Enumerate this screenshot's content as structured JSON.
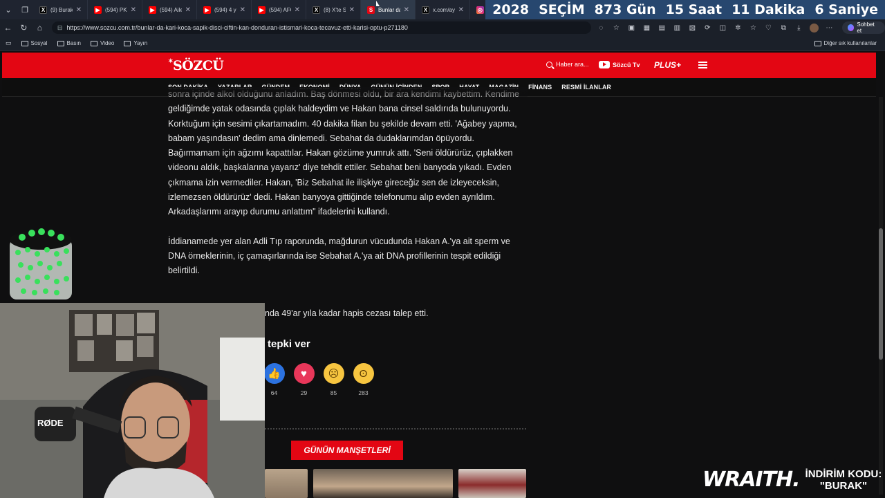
{
  "browser": {
    "tabs": [
      {
        "label": "(9) BurakSe",
        "icon": "x-icon"
      },
      {
        "label": "(594) PKK/Y",
        "icon": "youtube-icon"
      },
      {
        "label": "(594) Aile e",
        "icon": "youtube-icon"
      },
      {
        "label": "(594) 4 yaş",
        "icon": "youtube-icon"
      },
      {
        "label": "(594) AFGA",
        "icon": "youtube-icon"
      },
      {
        "label": "(8) X'te Sö",
        "icon": "x-icon"
      },
      {
        "label": "Bunlar da k",
        "icon": "sozcu-icon",
        "active": true
      },
      {
        "label": "x.com/ayk",
        "icon": "x-icon"
      },
      {
        "label": "(9) Instagra",
        "icon": "instagram-icon"
      }
    ],
    "url": "https://www.sozcu.com.tr/bunlar-da-kari-koca-sapik-disci-ciftin-kan-donduran-istismari-koca-tecavuz-etti-karisi-optu-p271180",
    "chat_button": "Sohbet et",
    "bookmarks": [
      "Sosyal",
      "Basın",
      "Video",
      "Yayın"
    ],
    "other_bookmarks": "Diğer sık kullanılanlar"
  },
  "countdown": {
    "year": "2028",
    "title": "SEÇİM",
    "days": "873 Gün",
    "hours": "15 Saat",
    "minutes": "11 Dakika",
    "seconds": "6 Saniye"
  },
  "site": {
    "logo": "SÖZCÜ",
    "search_placeholder": "Haber ara...",
    "tv_label": "Sözcü Tv",
    "plus_label": "PLUS+",
    "nav": [
      "SON DAKİKA",
      "YAZARLAR",
      "GÜNDEM",
      "EKONOMİ",
      "DÜNYA",
      "GÜNÜN İÇİNDEN",
      "SPOR",
      "HAYAT",
      "MAGAZİN",
      "FİNANS",
      "RESMİ İLANLAR"
    ],
    "accent": "#e30613"
  },
  "article": {
    "p1": "sonra içinde alkol olduğunu anladım. Baş dönmesi oldu, bir ara kendimi kaybettim. Kendime geldiğimde yatak odasında çıplak haldeydim ve Hakan bana cinsel saldırıda bulunuyordu. Korktuğum için sesimi çıkartamadım. 40 dakika filan bu şekilde devam etti. 'Ağabey yapma, babam yaşındasın' dedim ama dinlemedi. Sebahat da dudaklarımdan öpüyordu. Bağırmamam için ağzımı kapattılar. Hakan gözüme yumruk attı. 'Seni öldürürüz, çıplakken videonu aldık, başkalarına yayarız' diye tehdit ettiler. Sebahat beni banyoda yıkadı. Evden çıkmama izin vermediler. Hakan, 'Biz Sebahat ile ilişkiye gireceğiz sen de izleyeceksin, izlemezsen öldürürüz' dedi. Hakan banyoya gittiğinde telefonumu alıp evden ayrıldım. Arkadaşlarımı arayıp durumu anlattım\" ifadelerini kullandı.",
    "p2": "İddianamede yer alan Adli Tıp raporunda, mağdurun vücudunda Hakan A.'ya ait sperm ve DNA örneklerinin, iç çamaşırlarında ise Sebahat A.'ya ait DNA profillerinin tespit edildiği belirtildi.",
    "p3_visible": "nda 49'ar yıla kadar hapis cezası talep etti.",
    "react_title": "tepki ver",
    "reactions": [
      {
        "icon": "thumbs-up-icon",
        "count": "64"
      },
      {
        "icon": "heart-icon",
        "count": "29"
      },
      {
        "icon": "sad-face-icon",
        "count": "85"
      },
      {
        "icon": "surprised-face-icon",
        "count": "283"
      }
    ],
    "headlines_label": "GÜNÜN MANŞETLERİ"
  },
  "stream_overlay": {
    "brand": "WRAITH.",
    "code_label": "İNDİRİM KODU:",
    "code": "\"BURAK\""
  }
}
